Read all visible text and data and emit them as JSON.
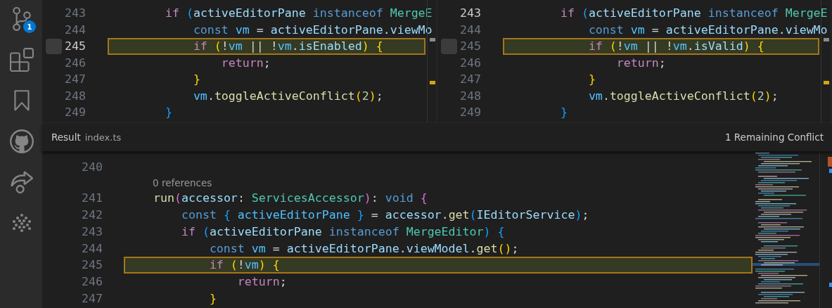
{
  "activity_bar": {
    "items": [
      {
        "kind": "source-control",
        "badge": "1",
        "selected": false
      },
      {
        "kind": "extensions",
        "selected": false
      },
      {
        "kind": "bookmarks",
        "selected": false
      },
      {
        "kind": "github",
        "selected": false
      },
      {
        "kind": "live-share",
        "selected": false
      },
      {
        "kind": "network",
        "selected": false
      }
    ]
  },
  "input_panes": [
    {
      "conflict_checkbox": {
        "checked": false
      },
      "lines": [
        {
          "number": "243",
          "active": false,
          "conflict": false,
          "tokens": [
            {
              "text": "        if ",
              "kind": "control"
            },
            {
              "text": "(",
              "kind": "brace3"
            },
            {
              "text": "activeEditorPane ",
              "kind": "variable"
            },
            {
              "text": "instanceof ",
              "kind": "keyword"
            },
            {
              "text": "MergeE",
              "kind": "type"
            }
          ]
        },
        {
          "number": "244",
          "active": false,
          "conflict": false,
          "tokens": [
            {
              "text": "            const ",
              "kind": "keyword"
            },
            {
              "text": "vm",
              "kind": "constant"
            },
            {
              "text": " = ",
              "kind": "plain"
            },
            {
              "text": "activeEditorPane",
              "kind": "variable"
            },
            {
              "text": ".",
              "kind": "plain"
            },
            {
              "text": "viewMo",
              "kind": "variable"
            }
          ]
        },
        {
          "number": "245",
          "active": true,
          "conflict": true,
          "tokens": [
            {
              "text": "            if ",
              "kind": "control"
            },
            {
              "text": "(",
              "kind": "brace1"
            },
            {
              "text": "!",
              "kind": "plain"
            },
            {
              "text": "vm",
              "kind": "constant"
            },
            {
              "text": " || !",
              "kind": "plain"
            },
            {
              "text": "vm",
              "kind": "constant"
            },
            {
              "text": ".",
              "kind": "plain"
            },
            {
              "text": "isEnabled",
              "kind": "variable"
            },
            {
              "text": ")",
              "kind": "brace1"
            },
            {
              "text": " {",
              "kind": "brace1"
            }
          ]
        },
        {
          "number": "246",
          "active": false,
          "conflict": false,
          "tokens": [
            {
              "text": "                return",
              "kind": "control"
            },
            {
              "text": ";",
              "kind": "plain"
            }
          ]
        },
        {
          "number": "247",
          "active": false,
          "conflict": false,
          "tokens": [
            {
              "text": "            }",
              "kind": "brace1"
            }
          ]
        },
        {
          "number": "248",
          "active": false,
          "conflict": false,
          "tokens": [
            {
              "text": "            vm",
              "kind": "constant"
            },
            {
              "text": ".",
              "kind": "plain"
            },
            {
              "text": "toggleActiveConflict",
              "kind": "function"
            },
            {
              "text": "(",
              "kind": "brace1"
            },
            {
              "text": "2",
              "kind": "number"
            },
            {
              "text": ")",
              "kind": "brace1"
            },
            {
              "text": ";",
              "kind": "plain"
            }
          ]
        },
        {
          "number": "249",
          "active": false,
          "conflict": false,
          "tokens": [
            {
              "text": "        }",
              "kind": "brace3"
            }
          ]
        }
      ]
    },
    {
      "conflict_checkbox": {
        "checked": false
      },
      "lines": [
        {
          "number": "243",
          "active": true,
          "conflict": false,
          "tokens": [
            {
              "text": "        if ",
              "kind": "control"
            },
            {
              "text": "(",
              "kind": "brace3"
            },
            {
              "text": "activeEditorPane ",
              "kind": "variable"
            },
            {
              "text": "instanceof ",
              "kind": "keyword"
            },
            {
              "text": "MergeE",
              "kind": "type"
            }
          ]
        },
        {
          "number": "244",
          "active": false,
          "conflict": false,
          "tokens": [
            {
              "text": "            const ",
              "kind": "keyword"
            },
            {
              "text": "vm",
              "kind": "constant"
            },
            {
              "text": " = ",
              "kind": "plain"
            },
            {
              "text": "activeEditorPane",
              "kind": "variable"
            },
            {
              "text": ".",
              "kind": "plain"
            },
            {
              "text": "viewMo",
              "kind": "variable"
            }
          ]
        },
        {
          "number": "245",
          "active": false,
          "conflict": true,
          "tokens": [
            {
              "text": "            if ",
              "kind": "control"
            },
            {
              "text": "(",
              "kind": "brace1"
            },
            {
              "text": "!",
              "kind": "plain"
            },
            {
              "text": "vm",
              "kind": "constant"
            },
            {
              "text": " || !",
              "kind": "plain"
            },
            {
              "text": "vm",
              "kind": "constant"
            },
            {
              "text": ".",
              "kind": "plain"
            },
            {
              "text": "isValid",
              "kind": "variable"
            },
            {
              "text": ")",
              "kind": "brace1"
            },
            {
              "text": " {",
              "kind": "brace1"
            }
          ]
        },
        {
          "number": "246",
          "active": false,
          "conflict": false,
          "tokens": [
            {
              "text": "                return",
              "kind": "control"
            },
            {
              "text": ";",
              "kind": "plain"
            }
          ]
        },
        {
          "number": "247",
          "active": false,
          "conflict": false,
          "tokens": [
            {
              "text": "            }",
              "kind": "brace1"
            }
          ]
        },
        {
          "number": "248",
          "active": false,
          "conflict": false,
          "tokens": [
            {
              "text": "            vm",
              "kind": "constant"
            },
            {
              "text": ".",
              "kind": "plain"
            },
            {
              "text": "toggleActiveConflict",
              "kind": "function"
            },
            {
              "text": "(",
              "kind": "brace1"
            },
            {
              "text": "2",
              "kind": "number"
            },
            {
              "text": ")",
              "kind": "brace1"
            },
            {
              "text": ";",
              "kind": "plain"
            }
          ]
        },
        {
          "number": "249",
          "active": false,
          "conflict": false,
          "tokens": [
            {
              "text": "        }",
              "kind": "brace3"
            }
          ]
        }
      ]
    }
  ],
  "result": {
    "title": "Result",
    "file": "index.ts",
    "status": "1 Remaining Conflict",
    "lines": [
      {
        "kind": "code",
        "number": "240",
        "conflict": false
      },
      {
        "kind": "codelens",
        "text": "0 references"
      },
      {
        "kind": "code",
        "number": "241",
        "conflict": false,
        "tokens": [
          {
            "text": "    run",
            "kind": "function"
          },
          {
            "text": "(",
            "kind": "brace2"
          },
          {
            "text": "accessor",
            "kind": "variable"
          },
          {
            "text": ": ",
            "kind": "plain"
          },
          {
            "text": "ServicesAccessor",
            "kind": "type"
          },
          {
            "text": ")",
            "kind": "brace2"
          },
          {
            "text": ": ",
            "kind": "plain"
          },
          {
            "text": "void ",
            "kind": "keyword"
          },
          {
            "text": "{",
            "kind": "brace2"
          }
        ]
      },
      {
        "kind": "code",
        "number": "242",
        "conflict": false,
        "tokens": [
          {
            "text": "        const ",
            "kind": "keyword"
          },
          {
            "text": "{ ",
            "kind": "brace3"
          },
          {
            "text": "activeEditorPane ",
            "kind": "constant"
          },
          {
            "text": "}",
            "kind": "brace3"
          },
          {
            "text": " = ",
            "kind": "plain"
          },
          {
            "text": "accessor",
            "kind": "variable"
          },
          {
            "text": ".",
            "kind": "plain"
          },
          {
            "text": "get",
            "kind": "function"
          },
          {
            "text": "(",
            "kind": "brace3"
          },
          {
            "text": "IEditorService",
            "kind": "variable"
          },
          {
            "text": ")",
            "kind": "brace3"
          },
          {
            "text": ";",
            "kind": "plain"
          }
        ]
      },
      {
        "kind": "code",
        "number": "243",
        "conflict": false,
        "tokens": [
          {
            "text": "        if ",
            "kind": "control"
          },
          {
            "text": "(",
            "kind": "brace3"
          },
          {
            "text": "activeEditorPane ",
            "kind": "variable"
          },
          {
            "text": "instanceof ",
            "kind": "keyword"
          },
          {
            "text": "MergeEditor",
            "kind": "type"
          },
          {
            "text": ")",
            "kind": "brace3"
          },
          {
            "text": " {",
            "kind": "brace3"
          }
        ]
      },
      {
        "kind": "code",
        "number": "244",
        "conflict": false,
        "tokens": [
          {
            "text": "            const ",
            "kind": "keyword"
          },
          {
            "text": "vm",
            "kind": "constant"
          },
          {
            "text": " = ",
            "kind": "plain"
          },
          {
            "text": "activeEditorPane",
            "kind": "variable"
          },
          {
            "text": ".",
            "kind": "plain"
          },
          {
            "text": "viewModel",
            "kind": "variable"
          },
          {
            "text": ".",
            "kind": "plain"
          },
          {
            "text": "get",
            "kind": "function"
          },
          {
            "text": "()",
            "kind": "brace1"
          },
          {
            "text": ";",
            "kind": "plain"
          }
        ]
      },
      {
        "kind": "code",
        "number": "245",
        "conflict": true,
        "tokens": [
          {
            "text": "            if ",
            "kind": "control"
          },
          {
            "text": "(",
            "kind": "brace1"
          },
          {
            "text": "!",
            "kind": "plain"
          },
          {
            "text": "vm",
            "kind": "constant"
          },
          {
            "text": ")",
            "kind": "brace1"
          },
          {
            "text": " {",
            "kind": "brace1"
          }
        ]
      },
      {
        "kind": "code",
        "number": "246",
        "conflict": false,
        "tokens": [
          {
            "text": "                return",
            "kind": "control"
          },
          {
            "text": ";",
            "kind": "plain"
          }
        ]
      },
      {
        "kind": "code",
        "number": "247",
        "conflict": false,
        "tokens": [
          {
            "text": "            }",
            "kind": "brace1"
          }
        ]
      }
    ]
  }
}
